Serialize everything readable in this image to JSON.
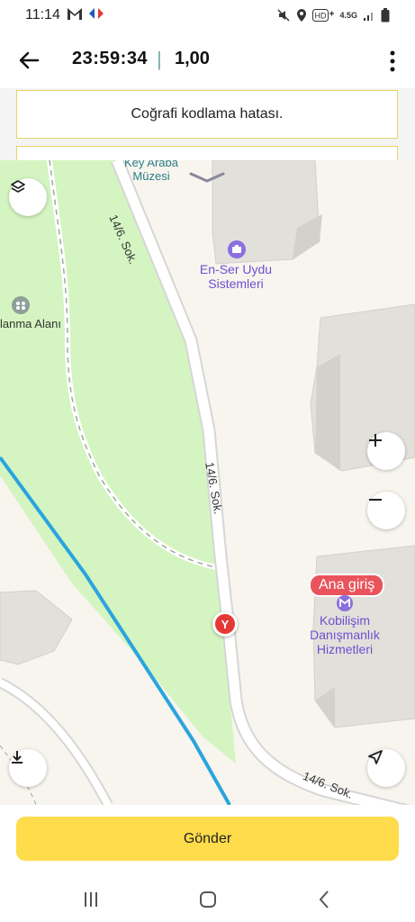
{
  "status_bar": {
    "time": "11:14",
    "left_icons": [
      "gmail-icon",
      "carrefour-icon"
    ],
    "right_icons": [
      "mute-icon",
      "location-icon",
      "hd-icon",
      "signal-icon",
      "battery-icon"
    ],
    "network_label": "4.5G"
  },
  "header": {
    "timer": "23:59:34",
    "separator": "|",
    "value": "1,00"
  },
  "notice": {
    "message": "Coğrafi kodlama hatası."
  },
  "map": {
    "labels": {
      "key_araba_line1": "Key Araba",
      "key_araba_line2": "Müzesi",
      "enser_line1": "En-Ser Uydu",
      "enser_line2": "Sistemleri",
      "park_area": "lanma Alanı",
      "street_top": "14/6. Sok.",
      "street_mid": "14/6. Sok.",
      "street_bottom": "14/6. Sok.",
      "kobilisim_line1": "Kobilişim",
      "kobilisim_line2": "Danışmanlık",
      "kobilisim_line3": "Hizmetleri",
      "ana_giris": "Ana giriş",
      "marker_letter": "Y"
    },
    "controls": [
      "layers-icon",
      "zoom-in-icon",
      "zoom-out-icon",
      "download-icon",
      "navigate-icon"
    ],
    "colors": {
      "park": "#d4f5c1",
      "route": "#2ba4de",
      "road": "#ffffff",
      "building": "#e2e0da",
      "marker": "#e53935"
    }
  },
  "actions": {
    "submit_label": "Gönder"
  },
  "nav_bar": {
    "buttons": [
      "recent-apps-icon",
      "home-icon",
      "back-icon"
    ]
  }
}
